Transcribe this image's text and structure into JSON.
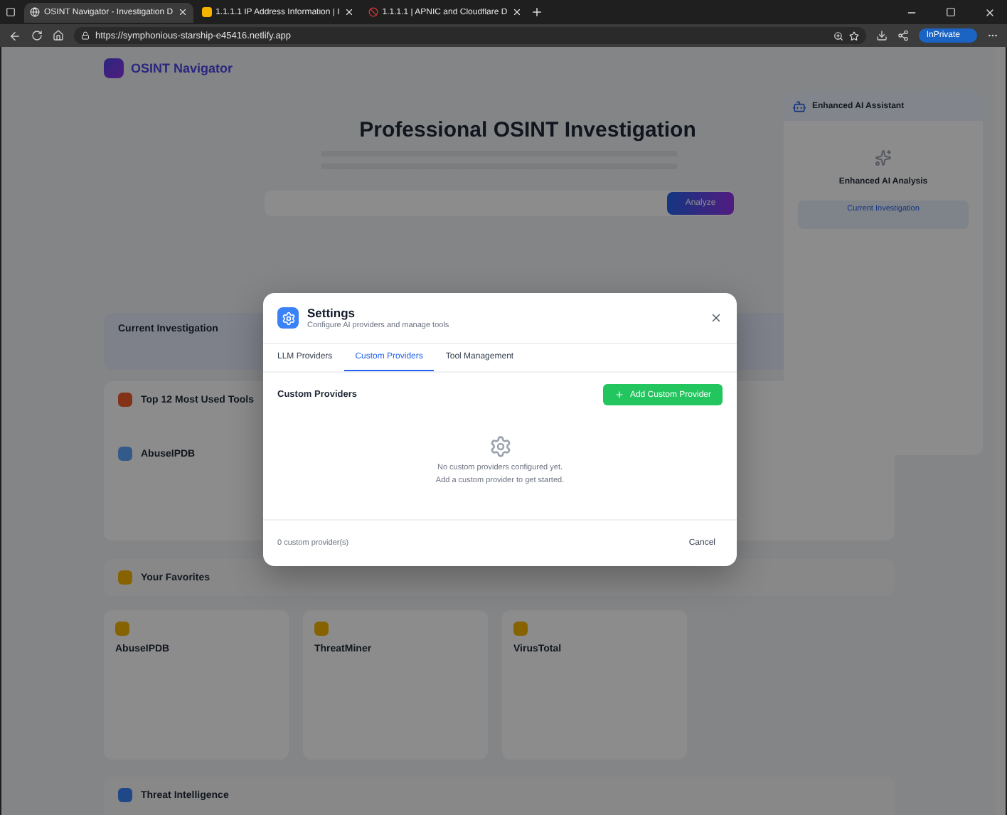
{
  "browser": {
    "tabs": [
      {
        "title": "OSINT Navigator - Investigation D",
        "selected": true,
        "kind": "globe"
      },
      {
        "title": "1.1.1.1 IP Address Information | I",
        "selected": false,
        "kind": "ip"
      },
      {
        "title": "1.1.1.1 | APNIC and Cloudflare D",
        "selected": false,
        "kind": "block"
      }
    ],
    "url": "https://symphonious-starship-e45416.netlify.app",
    "profile": "InPrivate"
  },
  "page": {
    "app_title": "OSINT Navigator",
    "hero_title": "Professional OSINT Investigation",
    "analyze_button": "Analyze",
    "assistant": {
      "title": "Enhanced AI Assistant",
      "heading": "Enhanced AI Analysis",
      "investigation": "Current Investigation"
    },
    "current_investigation": "Current Investigation",
    "top_tools": "Top 12 Most Used Tools",
    "top_tool": "AbuseIPDB",
    "favorites": "Your Favorites",
    "favorite_tools": [
      {
        "name": "AbuseIPDB"
      },
      {
        "name": "ThreatMiner"
      },
      {
        "name": "VirusTotal"
      }
    ],
    "category": "Threat Intelligence"
  },
  "dialog": {
    "title": "Settings",
    "subtitle": "Configure AI providers and manage tools",
    "tabs": [
      {
        "label": "LLM Providers",
        "selected": false
      },
      {
        "label": "Custom Providers",
        "selected": true
      },
      {
        "label": "Tool Management",
        "selected": false
      }
    ],
    "section_title": "Custom Providers",
    "add_button": "Add Custom Provider",
    "empty_lines": [
      "No custom providers configured yet.",
      "Add a custom provider to get started."
    ],
    "count": "0 custom provider(s)",
    "cancel_button": "Cancel"
  }
}
